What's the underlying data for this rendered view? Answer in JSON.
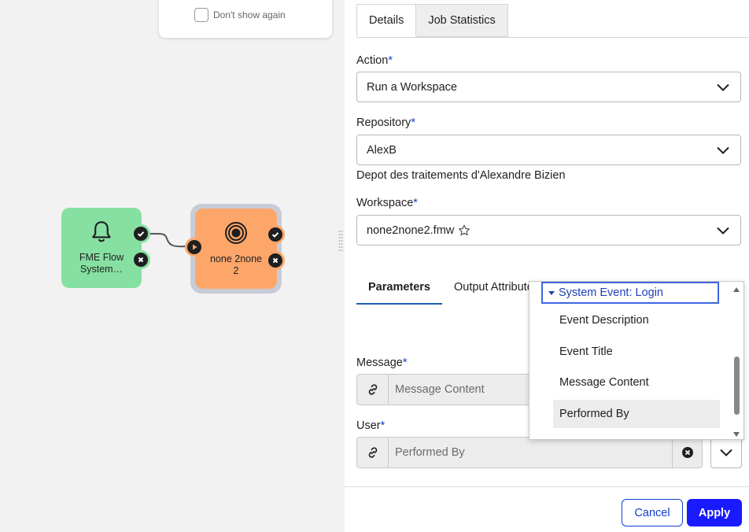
{
  "canvas": {
    "popup": {
      "dont_show_again": "Don't show again"
    },
    "nodes": [
      {
        "label": "FME Flow System…",
        "color": "#86e0a2",
        "icon": "bell-icon"
      },
      {
        "label": "none 2none 2",
        "color": "#fda66a",
        "icon": "target-icon"
      }
    ]
  },
  "panel": {
    "tabs": [
      "Details",
      "Job Statistics"
    ],
    "action": {
      "label": "Action",
      "value": "Run a Workspace"
    },
    "repository": {
      "label": "Repository",
      "value": "AlexB",
      "description": "Depot des traitements d'Alexandre Bizien"
    },
    "workspace": {
      "label": "Workspace",
      "value": "none2none2.fmw"
    },
    "param_tabs": [
      "Parameters",
      "Output Attributes"
    ],
    "message": {
      "label": "Message",
      "value": "Message Content"
    },
    "user": {
      "label": "User",
      "value": "Performed By"
    },
    "buttons": {
      "cancel": "Cancel",
      "apply": "Apply"
    },
    "required_marker": "*",
    "colors": {
      "primary": "#1a1aff",
      "accent": "#1040d0"
    }
  },
  "dropdown": {
    "group": "System Event: Login",
    "items": [
      "Event Description",
      "Event Title",
      "Message Content",
      "Performed By"
    ],
    "highlighted": "Performed By"
  }
}
